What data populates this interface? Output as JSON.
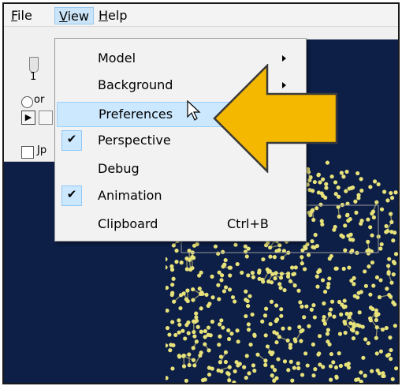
{
  "menubar": {
    "file": {
      "mnemonic": "F",
      "rest": "ile"
    },
    "view": {
      "mnemonic": "V",
      "rest": "iew"
    },
    "help": {
      "mnemonic": "H",
      "rest": "elp"
    }
  },
  "controls": {
    "slider_value": "1",
    "radio_label": "or",
    "checkbox_label": "Jp"
  },
  "view_menu": {
    "items": [
      {
        "label": "Model",
        "submenu": true
      },
      {
        "label": "Background",
        "submenu": true
      },
      {
        "label": "Preferences",
        "highlighted": true
      },
      {
        "label": "Perspective",
        "checked": true
      },
      {
        "label": "Debug"
      },
      {
        "label": "Animation",
        "checked": true
      },
      {
        "label": "Clipboard",
        "shortcut": "Ctrl+B"
      }
    ]
  },
  "icons": {
    "checkmark": "✔",
    "play": "▶"
  },
  "colors": {
    "viewer_background": "#0d1f47",
    "molecule_atoms": "#e8e27a",
    "molecule_bonds": "#8a8a6a",
    "menu_highlight": "#cce8ff",
    "callout_arrow": "#f5b800"
  }
}
